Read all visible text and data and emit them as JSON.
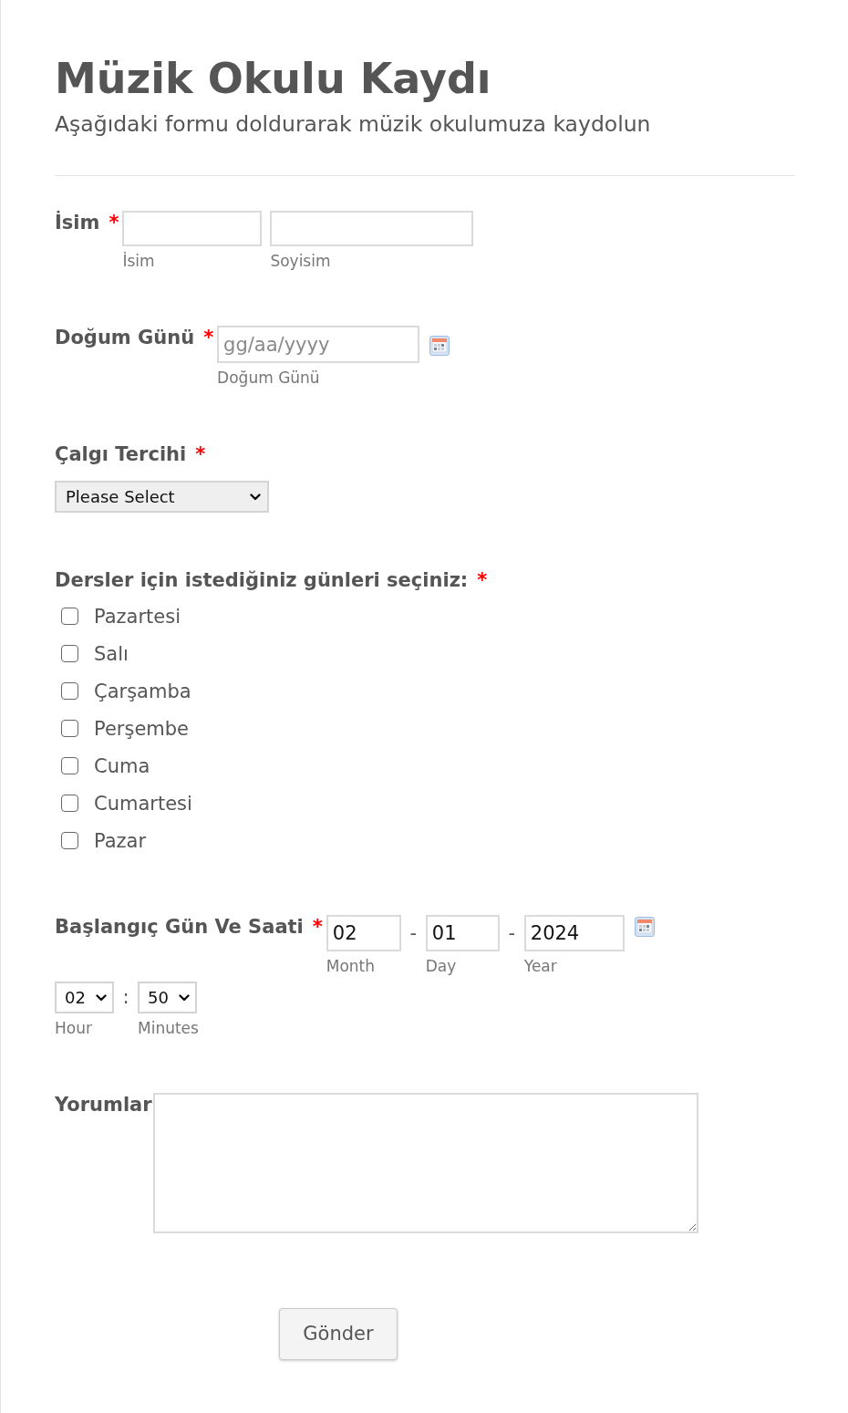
{
  "header": {
    "title": "Müzik Okulu Kaydı",
    "description": "Aşağıdaki formu doldurarak müzik okulumuza kaydolun"
  },
  "fields": [
    {
      "kind": "name",
      "label": "İsim",
      "required_mark": "*",
      "inputs": [
        {
          "caption": "İsim"
        },
        {
          "caption": "Soyisim"
        }
      ]
    },
    {
      "kind": "date",
      "label": "Doğum Günü",
      "required_mark": "*",
      "placeholder": "gg/aa/yyyy",
      "caption": "Doğum Günü"
    },
    {
      "kind": "dropdown",
      "label": "Çalgı Tercihi",
      "required_mark": "*",
      "value": "Please Select"
    },
    {
      "kind": "checkboxes",
      "label": "Dersler için istediğiniz günleri seçiniz:",
      "required_mark": "*",
      "options": [
        {
          "label": "Pazartesi",
          "checked": false
        },
        {
          "label": "Salı",
          "checked": false
        },
        {
          "label": "Çarşamba",
          "checked": false
        },
        {
          "label": "Perşembe",
          "checked": false
        },
        {
          "label": "Cuma",
          "checked": false
        },
        {
          "label": "Cumartesi",
          "checked": false
        },
        {
          "label": "Pazar",
          "checked": false
        }
      ]
    },
    {
      "kind": "datetime",
      "label": "Başlangıç Gün Ve Saati",
      "required_mark": "*",
      "date_parts": [
        {
          "value": "02",
          "caption": "Month"
        },
        {
          "value": "01",
          "caption": "Day"
        },
        {
          "value": "2024",
          "caption": "Year"
        }
      ],
      "date_separators": [
        "-",
        "-"
      ],
      "time_parts": [
        {
          "value": "02",
          "caption": "Hour"
        },
        {
          "value": "50",
          "caption": "Minutes"
        }
      ],
      "time_separator": ":"
    },
    {
      "kind": "textarea",
      "label": "Yorumlar"
    }
  ],
  "submit_button": {
    "label": "Gönder"
  }
}
